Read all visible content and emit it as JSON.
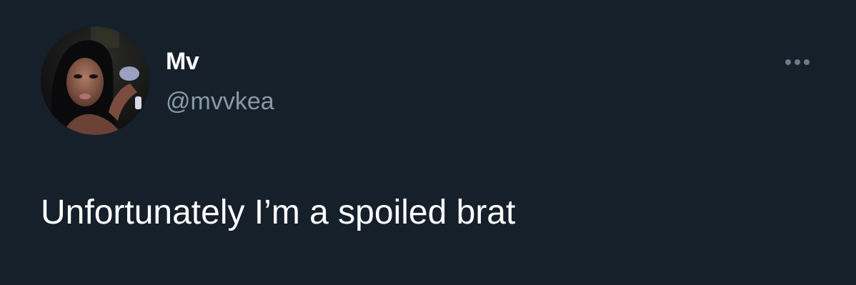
{
  "tweet": {
    "display_name": "Mv",
    "handle": "@mvvkea",
    "text": "Unfortunately I’m a spoiled brat",
    "more_icon": "more-horizontal-icon",
    "avatar_icon": "profile-photo"
  },
  "colors": {
    "background": "#15202b",
    "primary_text": "#ffffff",
    "secondary_text": "#8899a6",
    "icon_muted": "#6e7b87"
  }
}
